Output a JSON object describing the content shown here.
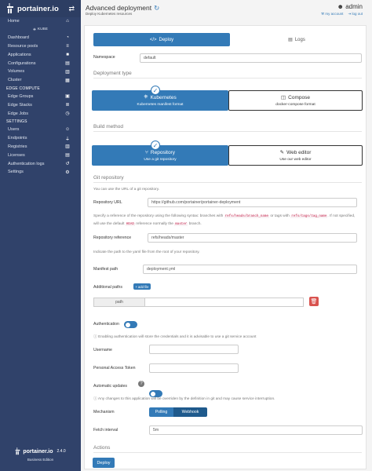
{
  "sidebar": {
    "brand": "portainer.io",
    "env_label": "KUBE",
    "items": [
      {
        "label": "Home",
        "icon": "home-icon",
        "glyph": "⌂"
      },
      {
        "label": "Dashboard",
        "icon": "dashboard-icon",
        "glyph": "◔"
      },
      {
        "label": "Resource pools",
        "icon": "layers-icon",
        "glyph": "≡"
      },
      {
        "label": "Applications",
        "icon": "cubes-icon",
        "glyph": "■"
      },
      {
        "label": "Configurations",
        "icon": "file-code-icon",
        "glyph": "▤"
      },
      {
        "label": "Volumes",
        "icon": "database-icon",
        "glyph": "▥"
      },
      {
        "label": "Cluster",
        "icon": "server-icon",
        "glyph": "▦"
      }
    ],
    "edge_section": "EDGE COMPUTE",
    "edge_items": [
      {
        "label": "Edge Groups",
        "icon": "objects-group-icon",
        "glyph": "▣"
      },
      {
        "label": "Edge Stacks",
        "icon": "layer-group-icon",
        "glyph": "≣"
      },
      {
        "label": "Edge Jobs",
        "icon": "clock-icon",
        "glyph": "◷"
      }
    ],
    "settings_section": "SETTINGS",
    "settings_items": [
      {
        "label": "Users",
        "icon": "users-icon",
        "glyph": "☺"
      },
      {
        "label": "Endpoints",
        "icon": "plug-icon",
        "glyph": "⏚"
      },
      {
        "label": "Registries",
        "icon": "database-icon",
        "glyph": "▥"
      },
      {
        "label": "Licenses",
        "icon": "file-contract-icon",
        "glyph": "▤"
      },
      {
        "label": "Authentication logs",
        "icon": "history-icon",
        "glyph": "↺"
      },
      {
        "label": "Settings",
        "icon": "cogs-icon",
        "glyph": "⚙"
      }
    ],
    "footer_brand": "portainer.io",
    "footer_version": "2.4.0",
    "footer_edition": "Business Edition"
  },
  "header": {
    "title": "Advanced deployment",
    "subtitle": "Deploy Kubernetes resources",
    "user": "admin",
    "my_account": "my account",
    "log_out": "log out"
  },
  "tabs": {
    "deploy": "Deploy",
    "logs": "Logs"
  },
  "form": {
    "namespace_label": "Namespace",
    "namespace_value": "default",
    "deployment_type_title": "Deployment type",
    "kubernetes_title": "Kubernetes",
    "kubernetes_desc": "Kubernetes manifest format",
    "compose_title": "Compose",
    "compose_desc": "docker-compose format",
    "build_method_title": "Build method",
    "repository_title": "Repository",
    "repository_desc": "Use a git repository",
    "webeditor_title": "Web editor",
    "webeditor_desc": "Use our web editor",
    "git_repository_title": "Git repository",
    "git_help": "You can use the URL of a git repository.",
    "repo_url_label": "Repository URL",
    "repo_url_placeholder": "https://github.com/portainer/portainer-deployment",
    "ref_help_1": "Specify a reference of the repository using the following syntax: branches with",
    "ref_code_1": "refs/heads/branch_name",
    "ref_help_2": "or tags with",
    "ref_code_2": "refs/tags/tag_name",
    "ref_help_3": ". If not specified, will use the default",
    "ref_code_3": "HEAD",
    "ref_help_4": "reference normally the",
    "ref_code_4": "master",
    "ref_help_5": "branch.",
    "repo_ref_label": "Repository reference",
    "repo_ref_placeholder": "refs/heads/master",
    "path_help": "Indicate the path to the yaml file from the root of your repository.",
    "manifest_path_label": "Manifest path",
    "manifest_path_value": "deployment.yml",
    "additional_paths_label": "Additional paths",
    "add_file_label": "add file",
    "path_addon": "path",
    "authentication_label": "Authentication",
    "auth_help": "Enabling authentication will store the credentials and it is advisable to use a git service account",
    "username_label": "Username",
    "pat_label": "Personal Access Token",
    "automatic_updates_label": "Automatic updates",
    "auto_help": "Any changes to this application will be overriden by the definition in git and may cause service interruption.",
    "mechanism_label": "Mechanism",
    "polling_label": "Polling",
    "webhook_label": "Webhook",
    "fetch_interval_label": "Fetch interval",
    "fetch_interval_value": "5m",
    "actions_title": "Actions",
    "deploy_button": "Deploy"
  },
  "colors": {
    "primary": "#337ab7",
    "sidebar": "#30426a",
    "danger": "#d9534f"
  }
}
